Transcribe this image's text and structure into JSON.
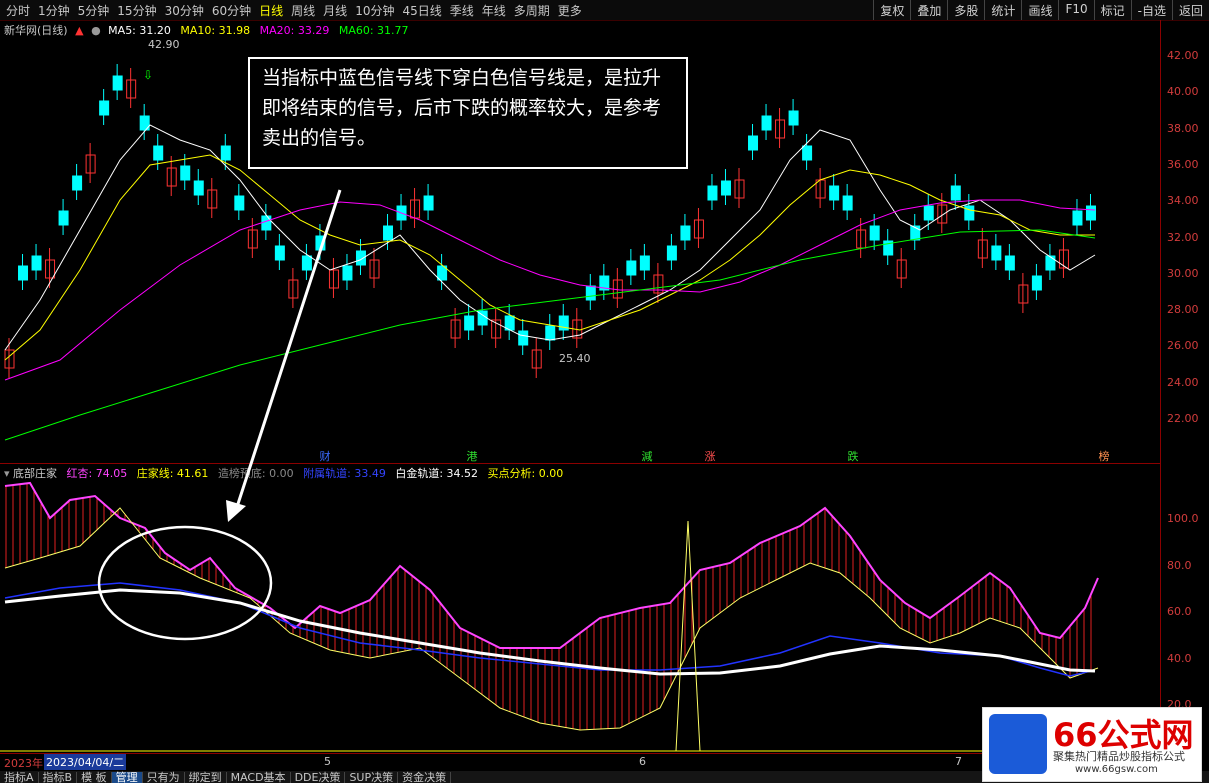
{
  "toolbar": {
    "periods": [
      "分时",
      "1分钟",
      "5分钟",
      "15分钟",
      "30分钟",
      "60分钟",
      "日线",
      "周线",
      "月线",
      "10分钟",
      "45日线",
      "季线",
      "年线",
      "多周期",
      "更多"
    ],
    "active_period": "日线",
    "right_buttons": [
      "复权",
      "叠加",
      "多股",
      "统计",
      "画线",
      "F10",
      "标记",
      "-自选",
      "返回"
    ]
  },
  "main_header": {
    "title": "新华网(日线)",
    "ma5": "MA5: 31.20",
    "ma10": "MA10: 31.98",
    "ma20": "MA20: 33.29",
    "ma60": "MA60: 31.77"
  },
  "annotations": {
    "high": "42.90",
    "low": "25.40",
    "callout": "当指标中蓝色信号线下穿白色信号线是，是拉升即将结束的信号，后市下跌的概率较大，是参考卖出的信号。"
  },
  "price_axis": [
    "42.00",
    "40.00",
    "38.00",
    "36.00",
    "34.00",
    "32.00",
    "30.00",
    "28.00",
    "26.00",
    "24.00",
    "22.00"
  ],
  "indicator_axis": [
    "100.0",
    "80.0",
    "60.0",
    "40.0",
    "20.0"
  ],
  "events": [
    "财",
    "港",
    "減",
    "涨",
    "跌",
    "榜"
  ],
  "indicator_header": {
    "name": "底部庄家",
    "hong": "红杏: 74.05",
    "zhuang": "庄家线: 41.61",
    "zaobang": "造榜预底: 0.00",
    "fushu": "附属轨道: 33.49",
    "baijin": "白金轨道: 34.52",
    "maidian": "买点分析: 0.00"
  },
  "date_bar": {
    "year": "2023年",
    "date": "2023/04/04/二",
    "months": [
      "5",
      "6",
      "7"
    ]
  },
  "tabs": [
    "指标A",
    "指标B",
    "模 板",
    "管理",
    "只有为",
    "绑定到",
    "MACD基本",
    "DDE决策",
    "SUP决策",
    "资金决策"
  ],
  "active_tab": "管理",
  "logo": {
    "title": "66公式网",
    "subtitle": "聚集热门精品炒股指标公式",
    "url": "www.66gsw.com"
  },
  "colors": {
    "up": "#ff3333",
    "down": "#00ffff",
    "ma5": "#ffffff",
    "ma10": "#ffff00",
    "ma20": "#ff00ff",
    "ma60": "#00ff00"
  }
}
